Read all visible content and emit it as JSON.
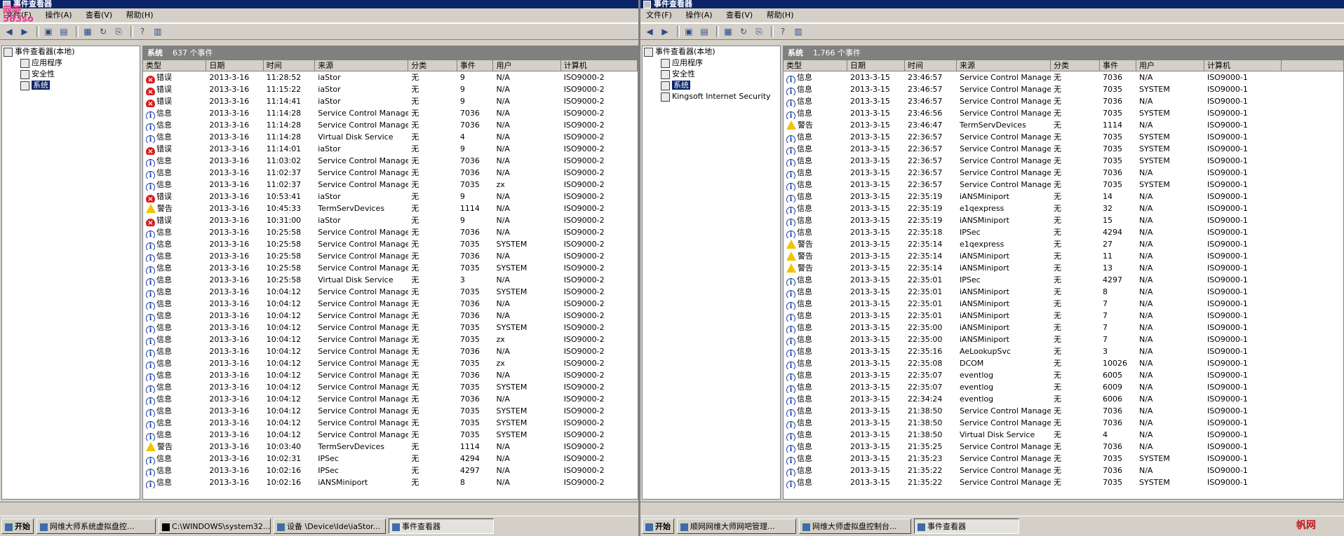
{
  "left": {
    "title": "事件查看器",
    "menus": [
      "文件(F)",
      "操作(A)",
      "查看(V)",
      "帮助(H)"
    ],
    "tree": [
      "事件查看器(本地)",
      "应用程序",
      "安全性",
      "系统"
    ],
    "pane_title": "系统",
    "pane_count": "637 个事件",
    "columns": [
      "类型",
      "日期",
      "时间",
      "来源",
      "分类",
      "事件",
      "用户",
      "计算机"
    ],
    "rows": [
      [
        "err",
        "错误",
        "2013-3-16",
        "11:28:52",
        "iaStor",
        "无",
        "9",
        "N/A",
        "ISO9000-2"
      ],
      [
        "err",
        "错误",
        "2013-3-16",
        "11:15:22",
        "iaStor",
        "无",
        "9",
        "N/A",
        "ISO9000-2"
      ],
      [
        "err",
        "错误",
        "2013-3-16",
        "11:14:41",
        "iaStor",
        "无",
        "9",
        "N/A",
        "ISO9000-2"
      ],
      [
        "info",
        "信息",
        "2013-3-16",
        "11:14:28",
        "Service Control Manager",
        "无",
        "7036",
        "N/A",
        "ISO9000-2"
      ],
      [
        "info",
        "信息",
        "2013-3-16",
        "11:14:28",
        "Service Control Manager",
        "无",
        "7036",
        "N/A",
        "ISO9000-2"
      ],
      [
        "info",
        "信息",
        "2013-3-16",
        "11:14:28",
        "Virtual Disk Service",
        "无",
        "4",
        "N/A",
        "ISO9000-2"
      ],
      [
        "err",
        "错误",
        "2013-3-16",
        "11:14:01",
        "iaStor",
        "无",
        "9",
        "N/A",
        "ISO9000-2"
      ],
      [
        "info",
        "信息",
        "2013-3-16",
        "11:03:02",
        "Service Control Manager",
        "无",
        "7036",
        "N/A",
        "ISO9000-2"
      ],
      [
        "info",
        "信息",
        "2013-3-16",
        "11:02:37",
        "Service Control Manager",
        "无",
        "7036",
        "N/A",
        "ISO9000-2"
      ],
      [
        "info",
        "信息",
        "2013-3-16",
        "11:02:37",
        "Service Control Manager",
        "无",
        "7035",
        "zx",
        "ISO9000-2"
      ],
      [
        "err",
        "错误",
        "2013-3-16",
        "10:53:41",
        "iaStor",
        "无",
        "9",
        "N/A",
        "ISO9000-2"
      ],
      [
        "warn",
        "警告",
        "2013-3-16",
        "10:45:33",
        "TermServDevices",
        "无",
        "1114",
        "N/A",
        "ISO9000-2"
      ],
      [
        "err",
        "错误",
        "2013-3-16",
        "10:31:00",
        "iaStor",
        "无",
        "9",
        "N/A",
        "ISO9000-2"
      ],
      [
        "info",
        "信息",
        "2013-3-16",
        "10:25:58",
        "Service Control Manager",
        "无",
        "7036",
        "N/A",
        "ISO9000-2"
      ],
      [
        "info",
        "信息",
        "2013-3-16",
        "10:25:58",
        "Service Control Manager",
        "无",
        "7035",
        "SYSTEM",
        "ISO9000-2"
      ],
      [
        "info",
        "信息",
        "2013-3-16",
        "10:25:58",
        "Service Control Manager",
        "无",
        "7036",
        "N/A",
        "ISO9000-2"
      ],
      [
        "info",
        "信息",
        "2013-3-16",
        "10:25:58",
        "Service Control Manager",
        "无",
        "7035",
        "SYSTEM",
        "ISO9000-2"
      ],
      [
        "info",
        "信息",
        "2013-3-16",
        "10:25:58",
        "Virtual Disk Service",
        "无",
        "3",
        "N/A",
        "ISO9000-2"
      ],
      [
        "info",
        "信息",
        "2013-3-16",
        "10:04:12",
        "Service Control Manager",
        "无",
        "7035",
        "SYSTEM",
        "ISO9000-2"
      ],
      [
        "info",
        "信息",
        "2013-3-16",
        "10:04:12",
        "Service Control Manager",
        "无",
        "7036",
        "N/A",
        "ISO9000-2"
      ],
      [
        "info",
        "信息",
        "2013-3-16",
        "10:04:12",
        "Service Control Manager",
        "无",
        "7036",
        "N/A",
        "ISO9000-2"
      ],
      [
        "info",
        "信息",
        "2013-3-16",
        "10:04:12",
        "Service Control Manager",
        "无",
        "7035",
        "SYSTEM",
        "ISO9000-2"
      ],
      [
        "info",
        "信息",
        "2013-3-16",
        "10:04:12",
        "Service Control Manager",
        "无",
        "7035",
        "zx",
        "ISO9000-2"
      ],
      [
        "info",
        "信息",
        "2013-3-16",
        "10:04:12",
        "Service Control Manager",
        "无",
        "7036",
        "N/A",
        "ISO9000-2"
      ],
      [
        "info",
        "信息",
        "2013-3-16",
        "10:04:12",
        "Service Control Manager",
        "无",
        "7035",
        "zx",
        "ISO9000-2"
      ],
      [
        "info",
        "信息",
        "2013-3-16",
        "10:04:12",
        "Service Control Manager",
        "无",
        "7036",
        "N/A",
        "ISO9000-2"
      ],
      [
        "info",
        "信息",
        "2013-3-16",
        "10:04:12",
        "Service Control Manager",
        "无",
        "7035",
        "SYSTEM",
        "ISO9000-2"
      ],
      [
        "info",
        "信息",
        "2013-3-16",
        "10:04:12",
        "Service Control Manager",
        "无",
        "7036",
        "N/A",
        "ISO9000-2"
      ],
      [
        "info",
        "信息",
        "2013-3-16",
        "10:04:12",
        "Service Control Manager",
        "无",
        "7035",
        "SYSTEM",
        "ISO9000-2"
      ],
      [
        "info",
        "信息",
        "2013-3-16",
        "10:04:12",
        "Service Control Manager",
        "无",
        "7035",
        "SYSTEM",
        "ISO9000-2"
      ],
      [
        "info",
        "信息",
        "2013-3-16",
        "10:04:12",
        "Service Control Manager",
        "无",
        "7035",
        "SYSTEM",
        "ISO9000-2"
      ],
      [
        "warn",
        "警告",
        "2013-3-16",
        "10:03:40",
        "TermServDevices",
        "无",
        "1114",
        "N/A",
        "ISO9000-2"
      ],
      [
        "info",
        "信息",
        "2013-3-16",
        "10:02:31",
        "IPSec",
        "无",
        "4294",
        "N/A",
        "ISO9000-2"
      ],
      [
        "info",
        "信息",
        "2013-3-16",
        "10:02:16",
        "IPSec",
        "无",
        "4297",
        "N/A",
        "ISO9000-2"
      ],
      [
        "info",
        "信息",
        "2013-3-16",
        "10:02:16",
        "iANSMiniport",
        "无",
        "8",
        "N/A",
        "ISO9000-2"
      ]
    ],
    "taskbar": [
      "开始",
      "网维大师系统虚拟盘控...",
      "C:\\WINDOWS\\system32...",
      "设备 \\Device\\Ide\\iaStor...",
      "事件查看器"
    ]
  },
  "right": {
    "title": "事件查看器",
    "menus": [
      "文件(F)",
      "操作(A)",
      "查看(V)",
      "帮助(H)"
    ],
    "tree": [
      "事件查看器(本地)",
      "应用程序",
      "安全性",
      "系统",
      "Kingsoft Internet Security"
    ],
    "pane_title": "系统",
    "pane_count": "1,766 个事件",
    "columns": [
      "类型",
      "日期",
      "时间",
      "来源",
      "分类",
      "事件",
      "用户",
      "计算机"
    ],
    "rows": [
      [
        "info",
        "信息",
        "2013-3-15",
        "23:46:57",
        "Service Control Manager",
        "无",
        "7036",
        "N/A",
        "ISO9000-1"
      ],
      [
        "info",
        "信息",
        "2013-3-15",
        "23:46:57",
        "Service Control Manager",
        "无",
        "7035",
        "SYSTEM",
        "ISO9000-1"
      ],
      [
        "info",
        "信息",
        "2013-3-15",
        "23:46:57",
        "Service Control Manager",
        "无",
        "7036",
        "N/A",
        "ISO9000-1"
      ],
      [
        "info",
        "信息",
        "2013-3-15",
        "23:46:56",
        "Service Control Manager",
        "无",
        "7035",
        "SYSTEM",
        "ISO9000-1"
      ],
      [
        "warn",
        "警告",
        "2013-3-15",
        "23:46:47",
        "TermServDevices",
        "无",
        "1114",
        "N/A",
        "ISO9000-1"
      ],
      [
        "info",
        "信息",
        "2013-3-15",
        "22:36:57",
        "Service Control Manager",
        "无",
        "7035",
        "SYSTEM",
        "ISO9000-1"
      ],
      [
        "info",
        "信息",
        "2013-3-15",
        "22:36:57",
        "Service Control Manager",
        "无",
        "7035",
        "SYSTEM",
        "ISO9000-1"
      ],
      [
        "info",
        "信息",
        "2013-3-15",
        "22:36:57",
        "Service Control Manager",
        "无",
        "7035",
        "SYSTEM",
        "ISO9000-1"
      ],
      [
        "info",
        "信息",
        "2013-3-15",
        "22:36:57",
        "Service Control Manager",
        "无",
        "7036",
        "N/A",
        "ISO9000-1"
      ],
      [
        "info",
        "信息",
        "2013-3-15",
        "22:36:57",
        "Service Control Manager",
        "无",
        "7035",
        "SYSTEM",
        "ISO9000-1"
      ],
      [
        "info",
        "信息",
        "2013-3-15",
        "22:35:19",
        "iANSMiniport",
        "无",
        "14",
        "N/A",
        "ISO9000-1"
      ],
      [
        "info",
        "信息",
        "2013-3-15",
        "22:35:19",
        "e1qexpress",
        "无",
        "32",
        "N/A",
        "ISO9000-1"
      ],
      [
        "info",
        "信息",
        "2013-3-15",
        "22:35:19",
        "iANSMiniport",
        "无",
        "15",
        "N/A",
        "ISO9000-1"
      ],
      [
        "info",
        "信息",
        "2013-3-15",
        "22:35:18",
        "IPSec",
        "无",
        "4294",
        "N/A",
        "ISO9000-1"
      ],
      [
        "warn",
        "警告",
        "2013-3-15",
        "22:35:14",
        "e1qexpress",
        "无",
        "27",
        "N/A",
        "ISO9000-1"
      ],
      [
        "warn",
        "警告",
        "2013-3-15",
        "22:35:14",
        "iANSMiniport",
        "无",
        "11",
        "N/A",
        "ISO9000-1"
      ],
      [
        "warn",
        "警告",
        "2013-3-15",
        "22:35:14",
        "iANSMiniport",
        "无",
        "13",
        "N/A",
        "ISO9000-1"
      ],
      [
        "info",
        "信息",
        "2013-3-15",
        "22:35:01",
        "IPSec",
        "无",
        "4297",
        "N/A",
        "ISO9000-1"
      ],
      [
        "info",
        "信息",
        "2013-3-15",
        "22:35:01",
        "iANSMiniport",
        "无",
        "8",
        "N/A",
        "ISO9000-1"
      ],
      [
        "info",
        "信息",
        "2013-3-15",
        "22:35:01",
        "iANSMiniport",
        "无",
        "7",
        "N/A",
        "ISO9000-1"
      ],
      [
        "info",
        "信息",
        "2013-3-15",
        "22:35:01",
        "iANSMiniport",
        "无",
        "7",
        "N/A",
        "ISO9000-1"
      ],
      [
        "info",
        "信息",
        "2013-3-15",
        "22:35:00",
        "iANSMiniport",
        "无",
        "7",
        "N/A",
        "ISO9000-1"
      ],
      [
        "info",
        "信息",
        "2013-3-15",
        "22:35:00",
        "iANSMiniport",
        "无",
        "7",
        "N/A",
        "ISO9000-1"
      ],
      [
        "info",
        "信息",
        "2013-3-15",
        "22:35:16",
        "AeLookupSvc",
        "无",
        "3",
        "N/A",
        "ISO9000-1"
      ],
      [
        "info",
        "信息",
        "2013-3-15",
        "22:35:08",
        "DCOM",
        "无",
        "10026",
        "N/A",
        "ISO9000-1"
      ],
      [
        "info",
        "信息",
        "2013-3-15",
        "22:35:07",
        "eventlog",
        "无",
        "6005",
        "N/A",
        "ISO9000-1"
      ],
      [
        "info",
        "信息",
        "2013-3-15",
        "22:35:07",
        "eventlog",
        "无",
        "6009",
        "N/A",
        "ISO9000-1"
      ],
      [
        "info",
        "信息",
        "2013-3-15",
        "22:34:24",
        "eventlog",
        "无",
        "6006",
        "N/A",
        "ISO9000-1"
      ],
      [
        "info",
        "信息",
        "2013-3-15",
        "21:38:50",
        "Service Control Manager",
        "无",
        "7036",
        "N/A",
        "ISO9000-1"
      ],
      [
        "info",
        "信息",
        "2013-3-15",
        "21:38:50",
        "Service Control Manager",
        "无",
        "7036",
        "N/A",
        "ISO9000-1"
      ],
      [
        "info",
        "信息",
        "2013-3-15",
        "21:38:50",
        "Virtual Disk Service",
        "无",
        "4",
        "N/A",
        "ISO9000-1"
      ],
      [
        "info",
        "信息",
        "2013-3-15",
        "21:35:25",
        "Service Control Manager",
        "无",
        "7036",
        "N/A",
        "ISO9000-1"
      ],
      [
        "info",
        "信息",
        "2013-3-15",
        "21:35:23",
        "Service Control Manager",
        "无",
        "7035",
        "SYSTEM",
        "ISO9000-1"
      ],
      [
        "info",
        "信息",
        "2013-3-15",
        "21:35:22",
        "Service Control Manager",
        "无",
        "7036",
        "N/A",
        "ISO9000-1"
      ],
      [
        "info",
        "信息",
        "2013-3-15",
        "21:35:22",
        "Service Control Manager",
        "无",
        "7035",
        "SYSTEM",
        "ISO9000-1"
      ]
    ],
    "taskbar": [
      "开始",
      "顺网网维大师网吧管理...",
      "网维大师虚拟盘控制台...",
      "事件查看器"
    ]
  },
  "watermarks": [
    "网吧",
    "58",
    "3so",
    "帆网"
  ]
}
